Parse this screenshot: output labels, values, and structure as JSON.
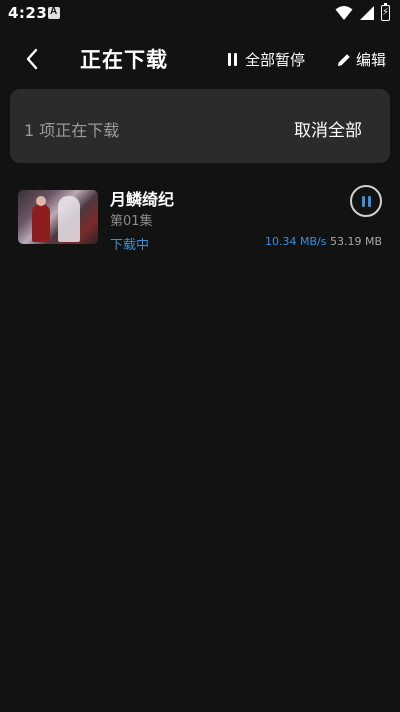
{
  "status_bar": {
    "time": "4:23",
    "icons": [
      "notification-a-icon",
      "wifi-icon",
      "signal-icon",
      "battery-charging-icon"
    ]
  },
  "header": {
    "title": "正在下载",
    "pause_all_label": "全部暂停",
    "edit_label": "编辑"
  },
  "panel": {
    "count_text": "1 项正在下载",
    "cancel_all_label": "取消全部"
  },
  "downloads": [
    {
      "title": "月鳞绮纪",
      "episode": "第01集",
      "status": "下载中",
      "speed": "10.34 MB/s",
      "size": "53.19 MB"
    }
  ],
  "colors": {
    "background": "#121212",
    "panel": "#2b2b2b",
    "accent": "#3b8fd6"
  }
}
